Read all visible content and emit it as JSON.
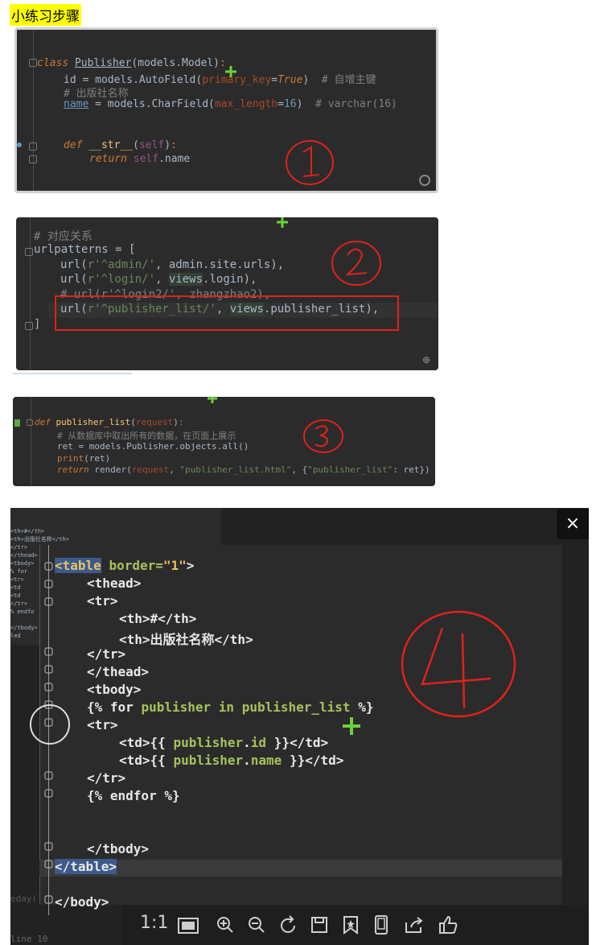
{
  "title": "小练习步骤",
  "panel1": {
    "lines": [
      "class Publisher(models.Model):",
      "id = models.AutoField(primary_key=True)  # 自增主键",
      "# 出版社名称",
      "name = models.CharField(max_length=16)  # varchar(16)",
      "def __str__(self):",
      "return self.name"
    ],
    "step": "1"
  },
  "panel2": {
    "lines": [
      "# 对应关系",
      "urlpatterns = [",
      "url(r'^admin/', admin.site.urls),",
      "url(r'^login/', views.login),",
      "# url(r'^login2/', zhangzhao2),",
      "url(r'^publisher_list/', views.publisher_list),",
      "]"
    ],
    "step": "2"
  },
  "panel3": {
    "lines": [
      "def publisher_list(request):",
      "# 从数据库中取出所有的数据，在页面上展示",
      "ret = models.Publisher.objects.all()",
      "print(ret)",
      "return render(request, \"publisher_list.html\", {\"publisher_list\": ret})"
    ],
    "step": "3"
  },
  "panel4": {
    "lines": [
      "<table border=\"1\">",
      "<thead>",
      "<tr>",
      "<th>#</th>",
      "<th>出版社名称</th>",
      "</tr>",
      "</thead>",
      "<tbody>",
      "{% for publisher in publisher_list %}",
      "<tr>",
      "<td>{{ publisher.id }}</td>",
      "<td>{{ publisher.name }}</td>",
      "</tr>",
      "{% endfor %}",
      "</tbody>",
      "</table>",
      "</body>"
    ],
    "step": "4",
    "behind_text": [
      "<th>#</th>",
      "<th>出版社名称</th>",
      "</tr>",
      "</thead>",
      "<tbody>",
      "% for",
      "<tr>",
      "<td",
      "<td",
      "</tr>",
      "% endfo",
      "</tbody>",
      "led",
      "eday(",
      "line 10"
    ],
    "toolbar_ratio": "1:1",
    "close": "×"
  }
}
